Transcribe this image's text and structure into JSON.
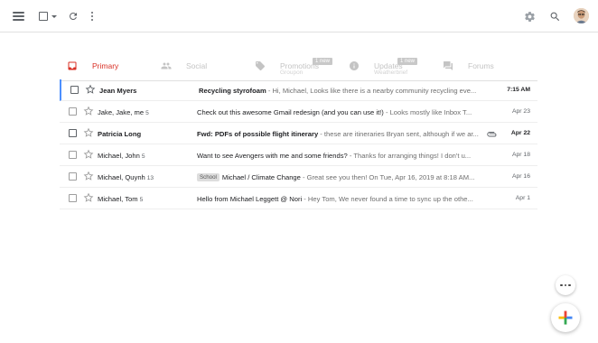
{
  "toolbar": {
    "menu_icon": "hamburger-icon",
    "select_icon": "checkbox-dropdown-icon",
    "refresh_icon": "refresh-icon",
    "more_icon": "more-vert-icon",
    "settings_icon": "gear-icon",
    "search_icon": "search-icon",
    "avatar_icon": "user-avatar"
  },
  "tabs": [
    {
      "label": "Primary",
      "icon": "inbox-icon",
      "active": true,
      "color": "#d93025"
    },
    {
      "label": "Social",
      "icon": "people-icon",
      "active": false
    },
    {
      "label": "Promotions",
      "icon": "tag-icon",
      "active": false,
      "badge": "1 new",
      "sub": "Groupon"
    },
    {
      "label": "Updates",
      "icon": "info-icon",
      "active": false,
      "badge": "1 new",
      "sub": "Weatherbrief"
    },
    {
      "label": "Forums",
      "icon": "forum-icon",
      "active": false
    }
  ],
  "emails": [
    {
      "sender": "Jean Myers",
      "count": "",
      "label": "",
      "subject": "Recycling styrofoam",
      "snippet": " - Hi, Michael, Looks like there is a nearby community recycling eve...",
      "date": "7:15 AM",
      "unread": true,
      "selected": true,
      "attachment": false
    },
    {
      "sender": "Jake, Jake, me",
      "count": "5",
      "label": "",
      "subject": "Check out this awesome Gmail redesign (and you can use it!)",
      "snippet": " - Looks mostly like Inbox T...",
      "date": "Apr 23",
      "unread": false,
      "selected": false,
      "attachment": false
    },
    {
      "sender": "Patricia Long",
      "count": "",
      "label": "",
      "subject": "Fwd: PDFs of possible flight itinerary",
      "snippet": " - these are itineraries Bryan sent, although if we ar...",
      "date": "Apr 22",
      "unread": true,
      "selected": false,
      "attachment": true
    },
    {
      "sender": "Michael, John",
      "count": "5",
      "label": "",
      "subject": "Want to see Avengers with me and some friends?",
      "snippet": " - Thanks for arranging things! I don't u...",
      "date": "Apr 18",
      "unread": false,
      "selected": false,
      "attachment": false
    },
    {
      "sender": "Michael, Quynh",
      "count": "13",
      "label": "School",
      "subject": "Michael / Climate Change",
      "snippet": " - Great see you then! On Tue, Apr 16, 2019 at 8:18 AM...",
      "date": "Apr 16",
      "unread": false,
      "selected": false,
      "attachment": false
    },
    {
      "sender": "Michael, Tom",
      "count": "5",
      "label": "",
      "subject": "Hello from Michael Leggett @ Nori",
      "snippet": " - Hey Tom, We never found a time to sync up the othe...",
      "date": "Apr 1",
      "unread": false,
      "selected": false,
      "attachment": false
    }
  ],
  "fab": {
    "more_icon": "more-horiz-icon",
    "compose_icon": "compose-plus-icon"
  },
  "colors": {
    "accent_red": "#d93025",
    "selected_bar": "#4d90fe",
    "compose_blue": "#4285f4",
    "compose_red": "#ea4335",
    "compose_yellow": "#fbbc04",
    "compose_green": "#34a853"
  }
}
